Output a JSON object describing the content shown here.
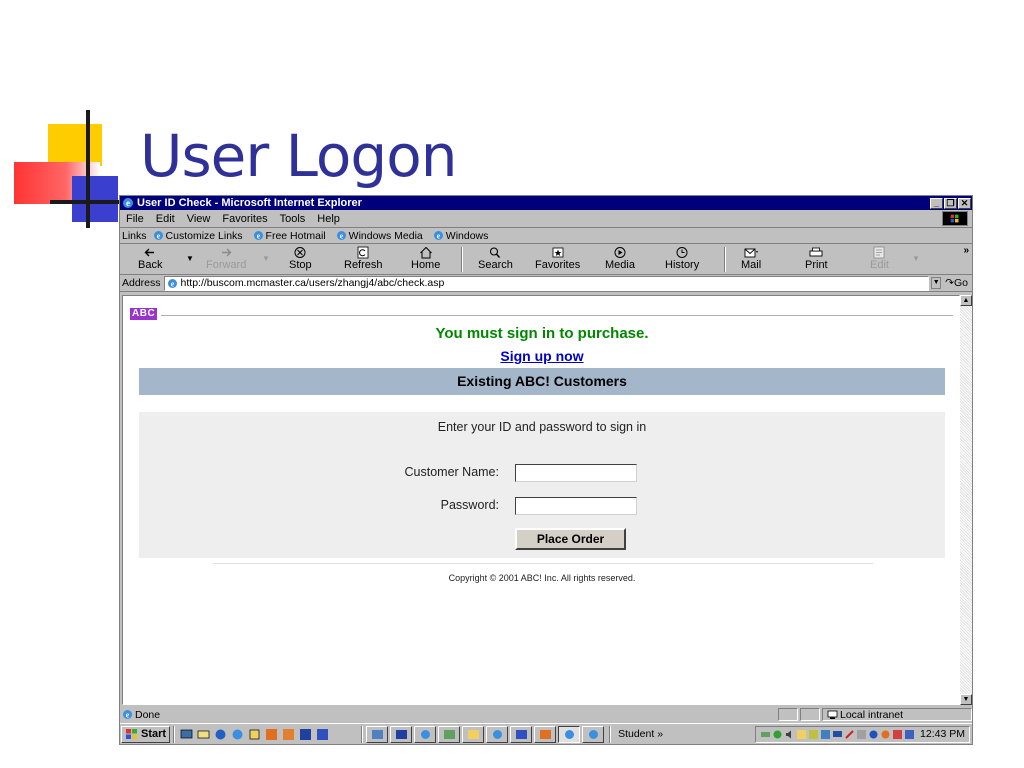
{
  "slide": {
    "title": "User Logon"
  },
  "window": {
    "title": "User ID Check - Microsoft Internet Explorer",
    "minimize": "_",
    "maximize": "❐",
    "close": "✕"
  },
  "menu": {
    "items": [
      "File",
      "Edit",
      "View",
      "Favorites",
      "Tools",
      "Help"
    ]
  },
  "links": {
    "label": "Links",
    "items": [
      "Customize Links",
      "Free Hotmail",
      "Windows Media",
      "Windows"
    ]
  },
  "toolbar": {
    "back": "Back",
    "forward": "Forward",
    "stop": "Stop",
    "refresh": "Refresh",
    "home": "Home",
    "search": "Search",
    "favorites": "Favorites",
    "media": "Media",
    "history": "History",
    "mail": "Mail",
    "print": "Print",
    "edit": "Edit",
    "more": "»"
  },
  "address": {
    "label": "Address",
    "url": "http://buscom.mcmaster.ca/users/zhangj4/abc/check.asp",
    "go": "Go"
  },
  "page": {
    "logo": "ABC",
    "sign_in_message": "You must sign in to purchase.",
    "signup_link": "Sign up now",
    "existing_header": "Existing ABC! Customers",
    "instructions": "Enter your ID and password to sign in",
    "customer_name_label": "Customer Name:",
    "customer_name_value": "",
    "password_label": "Password:",
    "password_value": "",
    "submit_label": "Place Order",
    "copyright": "Copyright © 2001 ABC! Inc. All rights reserved."
  },
  "status": {
    "text": "Done",
    "zone": "Local intranet"
  },
  "taskbar": {
    "start": "Start",
    "student": "Student",
    "more": "»",
    "clock": "12:43 PM"
  },
  "colors": {
    "title_blue": "#2f3199",
    "titlebar": "#00007b",
    "message_green": "#008800",
    "link_blue": "#0000cc",
    "header_bar": "#a4b6c9",
    "logo_purple": "#9933cc"
  }
}
